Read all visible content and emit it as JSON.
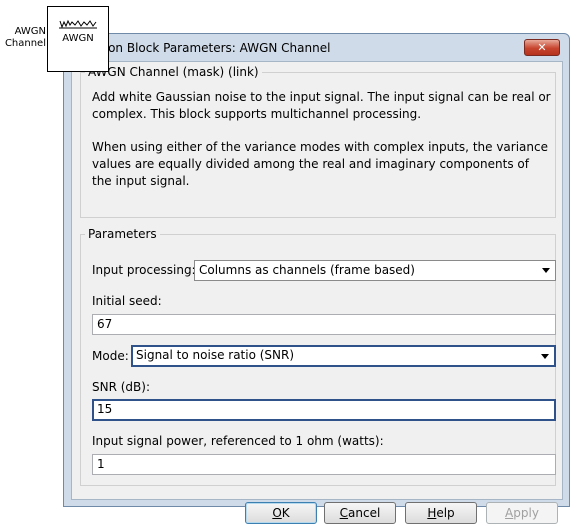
{
  "canvas": {
    "label_line1": "AWGN",
    "label_line2": "Channel",
    "block_text": "AWGN"
  },
  "dialog": {
    "title": "Function Block Parameters: AWGN Channel",
    "close_glyph": "✕",
    "description": {
      "legend": "AWGN Channel (mask) (link)",
      "para1": "Add white Gaussian noise to the input signal. The input signal can be real or complex. This block supports multichannel processing.",
      "para2": "When using either of the variance modes with complex inputs, the variance values are equally divided among the real and imaginary components of the input signal."
    },
    "parameters": {
      "legend": "Parameters",
      "input_processing_label": "Input processing:",
      "input_processing_value": "Columns as channels (frame based)",
      "initial_seed_label": "Initial seed:",
      "initial_seed_value": "67",
      "mode_label": "Mode:",
      "mode_value": "Signal to noise ratio  (SNR)",
      "snr_label": "SNR (dB):",
      "snr_value": "15",
      "power_label": "Input signal power, referenced to 1 ohm (watts):",
      "power_value": "1"
    },
    "buttons": {
      "ok_first": "O",
      "ok_rest": "K",
      "cancel_first": "C",
      "cancel_rest": "ancel",
      "help_first": "H",
      "help_rest": "elp",
      "apply_first": "A",
      "apply_rest": "pply"
    }
  },
  "colors": {
    "frame": "#cfdbe9",
    "focus_border": "#2e5289",
    "close_button": "#c7452e"
  }
}
